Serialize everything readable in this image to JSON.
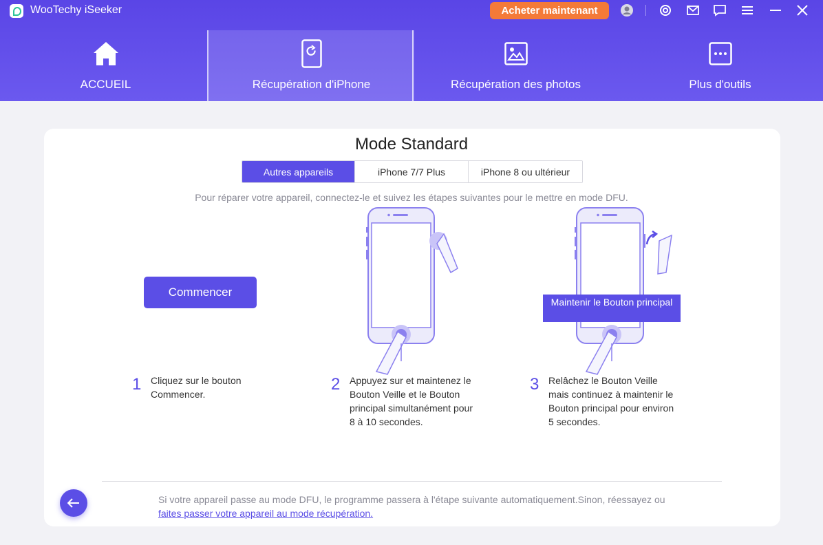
{
  "app": {
    "title": "WooTechy iSeeker",
    "buy_label": "Acheter maintenant"
  },
  "titlebar_icons": [
    "user-icon",
    "settings-icon",
    "mail-icon",
    "feedback-icon",
    "menu-icon",
    "minimize-icon",
    "close-icon"
  ],
  "nav": {
    "tabs": [
      {
        "label": "ACCUEIL",
        "icon": "home-icon"
      },
      {
        "label": "Récupération d'iPhone",
        "icon": "phone-refresh-icon",
        "active": true
      },
      {
        "label": "Récupération des photos",
        "icon": "photo-icon"
      },
      {
        "label": "Plus d'outils",
        "icon": "more-tools-icon"
      }
    ]
  },
  "main": {
    "title": "Mode Standard",
    "segments": [
      "Autres appareils",
      "iPhone 7/7 Plus",
      "iPhone 8 ou ultérieur"
    ],
    "active_segment": "Autres appareils",
    "instruction": "Pour réparer votre appareil, connectez-le et suivez les étapes suivantes pour le mettre en mode DFU.",
    "start_label": "Commencer",
    "tooltip": "Maintenir le Bouton principal",
    "steps": [
      {
        "num": "1",
        "text": "Cliquez sur le bouton Commencer."
      },
      {
        "num": "2",
        "text": "Appuyez sur et maintenez le Bouton Veille et le Bouton principal simultanément pour 8 à 10 secondes."
      },
      {
        "num": "3",
        "text": "Relâchez le Bouton Veille mais continuez à maintenir le Bouton principal pour environ 5 secondes."
      }
    ],
    "footer_prefix": "Si votre appareil passe au mode DFU, le programme passera à l'étape suivante automatiquement.Sinon, réessayez ou",
    "footer_link": "faites passer votre appareil au mode récupération."
  },
  "colors": {
    "accent": "#5b4ee6",
    "header": "#5a45e6",
    "buy": "#f47a38"
  }
}
